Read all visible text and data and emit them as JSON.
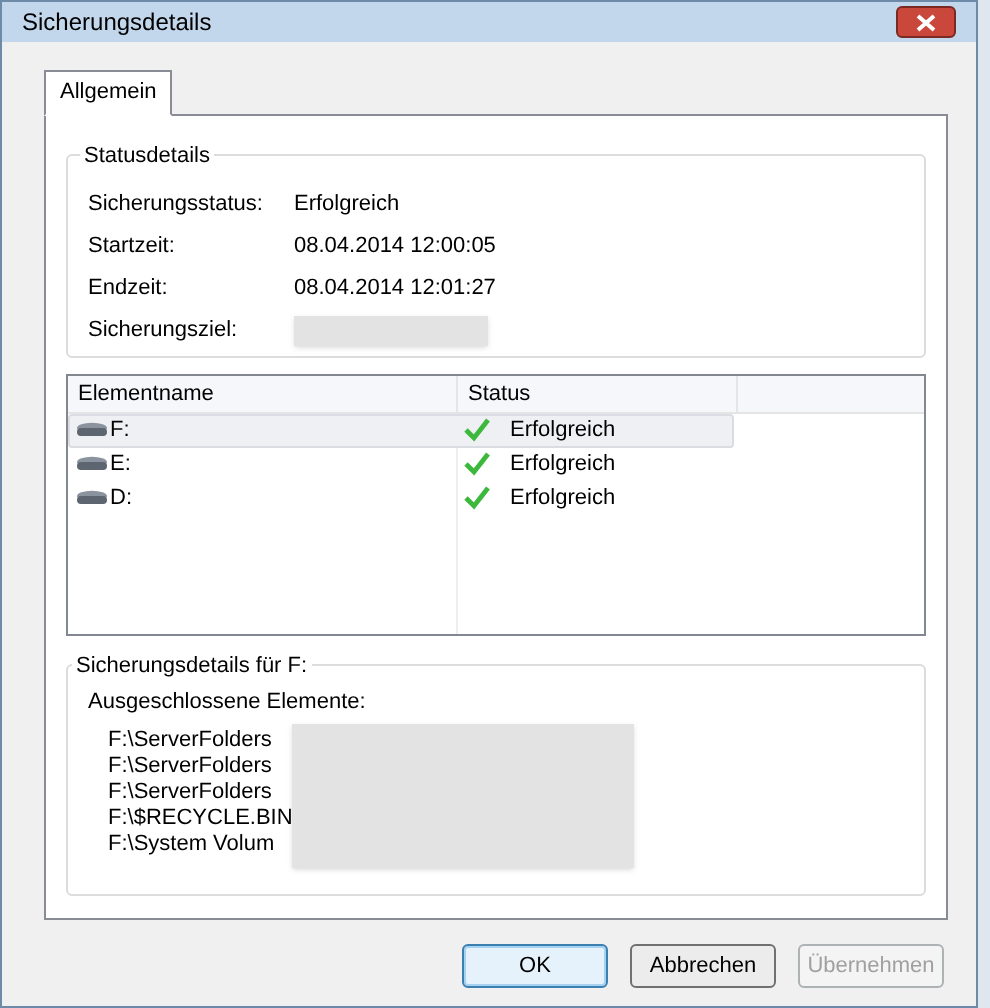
{
  "window": {
    "title": "Sicherungsdetails"
  },
  "tabs": [
    {
      "label": "Allgemein",
      "selected": true
    }
  ],
  "status_group": {
    "title": "Statusdetails",
    "fields": [
      {
        "label": "Sicherungsstatus:",
        "value": "Erfolgreich"
      },
      {
        "label": "Startzeit:",
        "value": "08.04.2014 12:00:05"
      },
      {
        "label": "Endzeit:",
        "value": "08.04.2014 12:01:27"
      },
      {
        "label": "Sicherungsziel:",
        "kind": "redacted"
      }
    ]
  },
  "items_table": {
    "columns": [
      "Elementname",
      "Status"
    ],
    "rows": [
      {
        "name": "F:",
        "status": "Erfolgreich",
        "selected": true
      },
      {
        "name": "E:",
        "status": "Erfolgreich",
        "selected": false
      },
      {
        "name": "D:",
        "status": "Erfolgreich",
        "selected": false
      }
    ]
  },
  "details_group": {
    "title": "Sicherungsdetails für F:",
    "subtitle": "Ausgeschlossene Elemente:",
    "paths": [
      "F:\\ServerFolders",
      "F:\\ServerFolders",
      "F:\\ServerFolders",
      "F:\\$RECYCLE.BIN",
      "F:\\System Volum"
    ]
  },
  "buttons": [
    {
      "label": "OK",
      "default": true,
      "disabled": false
    },
    {
      "label": "Abbrechen",
      "default": false,
      "disabled": false
    },
    {
      "label": "Übernehmen",
      "default": false,
      "disabled": true
    }
  ]
}
